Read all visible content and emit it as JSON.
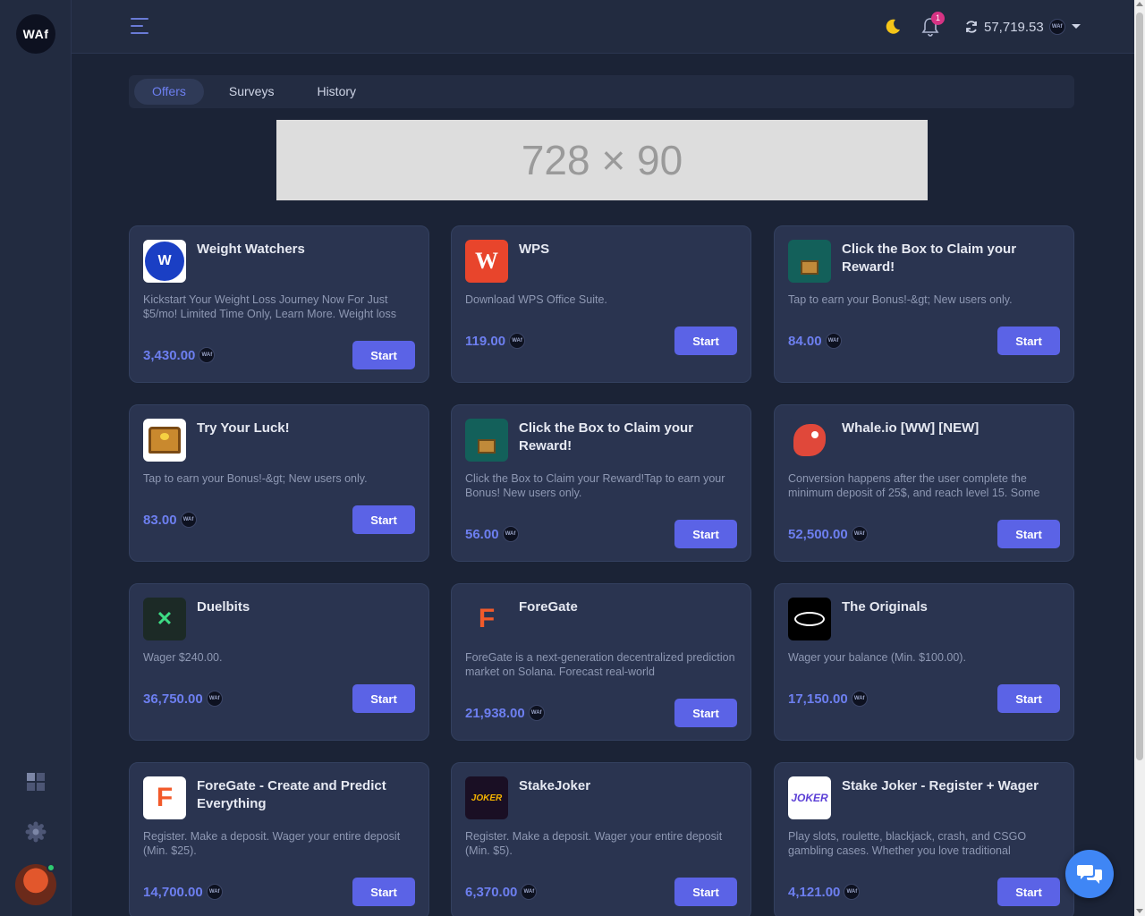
{
  "app": {
    "logo_text": "WAf"
  },
  "header": {
    "notifications_count": "1",
    "balance": "57,719.53",
    "coin_label": "WAf"
  },
  "tabs": [
    {
      "label": "Offers",
      "active": true
    },
    {
      "label": "Surveys",
      "active": false
    },
    {
      "label": "History",
      "active": false
    }
  ],
  "banner": {
    "text": "728 × 90"
  },
  "offers": [
    {
      "title": "Weight Watchers",
      "desc": "Kickstart Your Weight Loss Journey Now For Just $5/mo! Limited Time Only, Learn More. Weight loss",
      "points": "3,430.00",
      "button": "Start"
    },
    {
      "title": "WPS",
      "desc": "Download WPS Office Suite.",
      "points": "119.00",
      "button": "Start"
    },
    {
      "title": "Click the Box to Claim your Reward!",
      "desc": "Tap to earn your Bonus!-&gt; New users only.",
      "points": "84.00",
      "button": "Start"
    },
    {
      "title": "Try Your Luck!",
      "desc": "Tap to earn your Bonus!-&gt; New users only.",
      "points": "83.00",
      "button": "Start"
    },
    {
      "title": "Click the Box to Claim your Reward!",
      "desc": "Click the Box to Claim your Reward!Tap to earn your Bonus! New users only.",
      "points": "56.00",
      "button": "Start"
    },
    {
      "title": "Whale.io [WW] [NEW]",
      "desc": "Conversion happens after the user complete the minimum deposit of 25$, and reach level 15. Some",
      "points": "52,500.00",
      "button": "Start"
    },
    {
      "title": "Duelbits",
      "desc": "Wager $240.00.",
      "points": "36,750.00",
      "button": "Start"
    },
    {
      "title": "ForeGate",
      "desc": "ForeGate is a next-generation decentralized prediction market on Solana. Forecast real-world",
      "points": "21,938.00",
      "button": "Start"
    },
    {
      "title": "The Originals",
      "desc": "Wager your balance (Min. $100.00).",
      "points": "17,150.00",
      "button": "Start"
    },
    {
      "title": "ForeGate - Create and Predict Everything",
      "desc": "Register. Make a deposit. Wager your entire deposit (Min. $25).",
      "points": "14,700.00",
      "button": "Start"
    },
    {
      "title": "StakeJoker",
      "desc": "Register. Make a deposit. Wager your entire deposit (Min. $5).",
      "points": "6,370.00",
      "button": "Start"
    },
    {
      "title": "Stake Joker - Register + Wager",
      "desc": "Play slots, roulette, blackjack, crash, and CSGO gambling cases. Whether you love traditional",
      "points": "4,121.00",
      "button": "Start"
    }
  ],
  "icons": {
    "offer_icons": [
      "weight-watchers-logo-icon",
      "wps-logo-icon",
      "treasure-box-icon",
      "treasure-chest-icon",
      "treasure-box-icon",
      "whale-dragon-icon",
      "duelbits-logo-icon",
      "foregate-logo-icon",
      "the-originals-logo-icon",
      "foregate-logo-icon",
      "stakejoker-logo-icon",
      "stake-joker-logo-icon"
    ]
  },
  "colors": {
    "accent": "#5b63e6",
    "points": "#6d7ff0",
    "badge": "#d63384"
  }
}
